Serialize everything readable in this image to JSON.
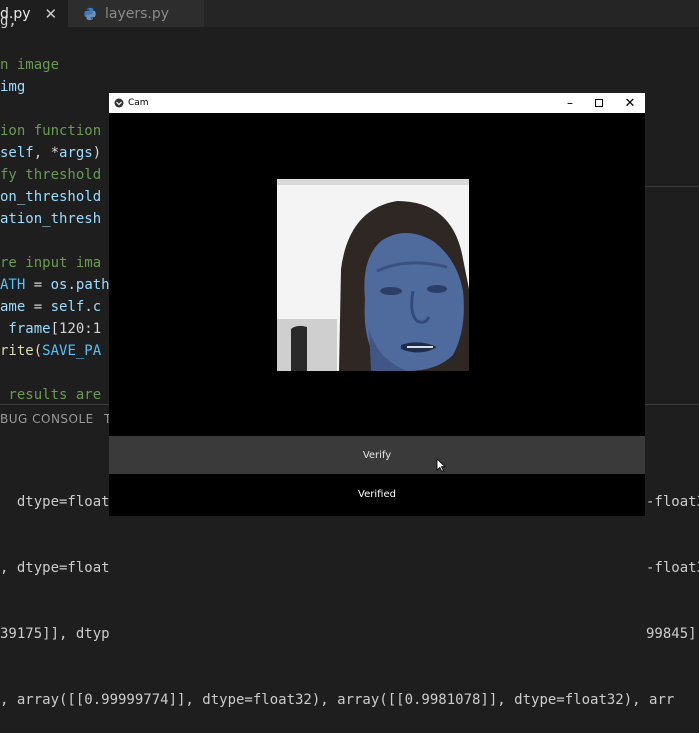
{
  "editor": {
    "tabs": [
      {
        "label": "d.py",
        "close": "✕",
        "active": true
      },
      {
        "label": "layers.py",
        "active": false
      }
    ],
    "code_lines": [
      [
        {
          "t": "g,",
          "c": "c-text"
        }
      ],
      [
        {
          "t": "",
          "c": "c-text"
        }
      ],
      [
        {
          "t": "n image",
          "c": "c-comment"
        }
      ],
      [
        {
          "t": "img",
          "c": "c-var"
        }
      ],
      [
        {
          "t": "",
          "c": "c-text"
        }
      ],
      [
        {
          "t": "ion function",
          "c": "c-comment"
        }
      ],
      [
        {
          "t": "self",
          "c": "c-var"
        },
        {
          "t": ", *",
          "c": "c-text"
        },
        {
          "t": "args",
          "c": "c-var"
        },
        {
          "t": ")",
          "c": "c-text"
        }
      ],
      [
        {
          "t": "fy threshold",
          "c": "c-comment"
        }
      ],
      [
        {
          "t": "on_threshold",
          "c": "c-var"
        }
      ],
      [
        {
          "t": "ation_thresh",
          "c": "c-var"
        }
      ],
      [
        {
          "t": "",
          "c": "c-text"
        }
      ],
      [
        {
          "t": "re input ima",
          "c": "c-comment"
        }
      ],
      [
        {
          "t": "ATH",
          "c": "c-const"
        },
        {
          "t": " = ",
          "c": "c-text"
        },
        {
          "t": "os",
          "c": "c-var"
        },
        {
          "t": ".",
          "c": "c-text"
        },
        {
          "t": "path",
          "c": "c-var"
        }
      ],
      [
        {
          "t": "ame",
          "c": "c-var"
        },
        {
          "t": " = ",
          "c": "c-text"
        },
        {
          "t": "self",
          "c": "c-var"
        },
        {
          "t": ".",
          "c": "c-text"
        },
        {
          "t": "c",
          "c": "c-var"
        }
      ],
      [
        {
          "t": " frame",
          "c": "c-var"
        },
        {
          "t": "[120:1",
          "c": "c-text"
        }
      ],
      [
        {
          "t": "rite",
          "c": "c-fn"
        },
        {
          "t": "(",
          "c": "c-text"
        },
        {
          "t": "SAVE_PA",
          "c": "c-const"
        }
      ],
      [
        {
          "t": "",
          "c": "c-text"
        }
      ],
      [
        {
          "t": " results are",
          "c": "c-comment"
        }
      ]
    ]
  },
  "panel": {
    "tab_debug": "BUG CONSOLE",
    "tab_next": "T",
    "terminal_lines": [
      "  dtype=float3",
      ", dtype=float",
      "39175]], dtyp",
      ", array([[0.99999774]], dtype=float32), array([[0.9981078]], dtype=float32), arr"
    ],
    "terminal_right": [
      "-float3",
      "-float3",
      "99845]",
      ""
    ]
  },
  "cam_window": {
    "title": "Cam",
    "verify_button": "Verify",
    "status_text": "Verified"
  },
  "icons": {
    "python": "python-file-icon",
    "window": "window-app-icon",
    "minimize": "minimize-icon",
    "maximize": "maximize-icon",
    "close": "close-icon",
    "cursor": "mouse-cursor-icon"
  },
  "colors": {
    "editor_bg": "#1e1e1e",
    "comment": "#6a9955",
    "variable": "#9cdcfe",
    "window_bg": "#000000",
    "button_bg": "#3a3a3a"
  }
}
